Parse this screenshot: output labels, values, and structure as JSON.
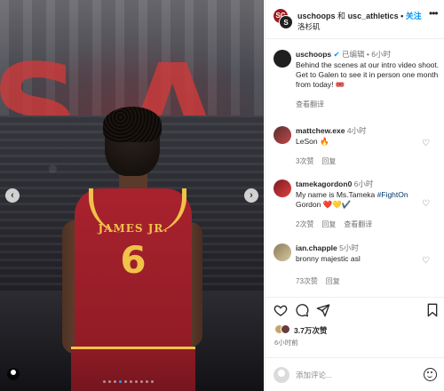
{
  "header": {
    "user1": "uschoops",
    "connector": "和",
    "user2": "usc_athletics",
    "follow_label": "关注",
    "subtitle": "洛杉矶"
  },
  "caption": {
    "username": "uschoops",
    "edited": "已编辑",
    "time": "6小时",
    "text": "Behind the scenes at our intro video shoot. Get to Galen to see it in person one month from today! 🎟️",
    "translate": "查看翻译"
  },
  "comments": [
    {
      "username": "mattchew.exe",
      "time": "4小时",
      "text": "LeSon 🔥",
      "likes": "3次赞",
      "reply": "回复",
      "translate": ""
    },
    {
      "username": "tamekagordon0",
      "time": "6小时",
      "text_prefix": "My name is Ms.Tameka ",
      "tag": "#FightOn",
      "text_suffix": "Gordon ❤️💛✔️",
      "likes": "2次赞",
      "reply": "回复",
      "translate": "查看翻译"
    },
    {
      "username": "ian.chapple",
      "time": "5小时",
      "text": "bronny majestic asl",
      "likes": "73次赞",
      "reply": "回复",
      "translate": ""
    }
  ],
  "actions": {
    "likes_text": "3.7万次赞",
    "post_time": "6小时前"
  },
  "add_comment": {
    "placeholder": "添加评论..."
  },
  "media": {
    "background_letters": [
      "S",
      "A"
    ],
    "jersey_name": "JAMES JR.",
    "jersey_number": "6",
    "carousel_count": 10,
    "carousel_active": 3
  },
  "colors": {
    "accent": "#0095f6",
    "jersey": "#9d1c22",
    "gold": "#f1c24a"
  }
}
